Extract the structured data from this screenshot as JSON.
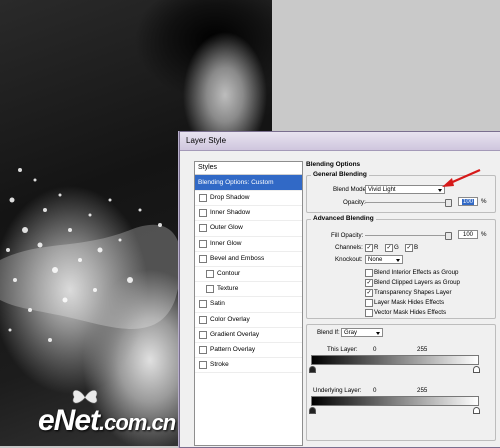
{
  "dialog": {
    "title": "Layer Style"
  },
  "stylelist": {
    "header": "Styles",
    "items": [
      {
        "label": "Blending Options: Custom",
        "selected": true,
        "checkbox": false
      },
      {
        "label": "Drop Shadow"
      },
      {
        "label": "Inner Shadow"
      },
      {
        "label": "Outer Glow"
      },
      {
        "label": "Inner Glow"
      },
      {
        "label": "Bevel and Emboss"
      },
      {
        "label": "Contour",
        "sub": true
      },
      {
        "label": "Texture",
        "sub": true
      },
      {
        "label": "Satin"
      },
      {
        "label": "Color Overlay"
      },
      {
        "label": "Gradient Overlay"
      },
      {
        "label": "Pattern Overlay"
      },
      {
        "label": "Stroke"
      }
    ]
  },
  "blending": {
    "title": "Blending Options",
    "general": {
      "title": "General Blending",
      "blend_mode_label": "Blend Mode:",
      "blend_mode_value": "Vivid Light",
      "opacity_label": "Opacity:",
      "opacity_value": "100",
      "opacity_unit": "%"
    },
    "advanced": {
      "title": "Advanced Blending",
      "fill_opacity_label": "Fill Opacity:",
      "fill_opacity_value": "100",
      "fill_opacity_unit": "%",
      "channels_label": "Channels:",
      "channels": [
        {
          "label": "R",
          "checked": true
        },
        {
          "label": "G",
          "checked": true
        },
        {
          "label": "B",
          "checked": true
        }
      ],
      "knockout_label": "Knockout:",
      "knockout_value": "None",
      "options": [
        {
          "label": "Blend Interior Effects as Group",
          "checked": false
        },
        {
          "label": "Blend Clipped Layers as Group",
          "checked": true
        },
        {
          "label": "Transparency Shapes Layer",
          "checked": true
        },
        {
          "label": "Layer Mask Hides Effects",
          "checked": false
        },
        {
          "label": "Vector Mask Hides Effects",
          "checked": false
        }
      ]
    },
    "blend_if": {
      "label": "Blend If:",
      "value": "Gray",
      "this_layer_label": "This Layer:",
      "this_layer_min": "0",
      "this_layer_max": "255",
      "underlying_label": "Underlying Layer:",
      "underlying_min": "0",
      "underlying_max": "255"
    }
  },
  "watermark": {
    "brand": "eNet",
    "suffix": ".com.cn"
  },
  "colors": {
    "selection": "#3169c6",
    "arrow": "#d61a1a"
  }
}
